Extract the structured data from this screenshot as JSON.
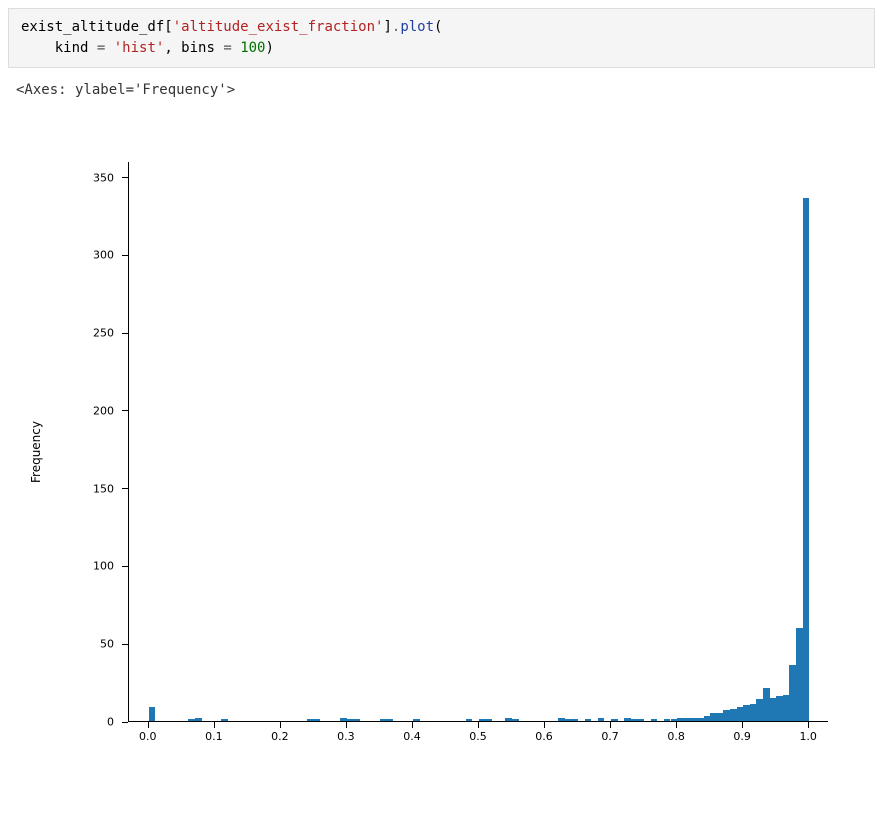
{
  "code": {
    "line1_parts": {
      "var": "exist_altitude_df",
      "lbracket": "[",
      "str": "'altitude_exist_fraction'",
      "rbracket": "]",
      "dot": ".",
      "call": "plot",
      "open": "("
    },
    "line2_parts": {
      "indent": "    ",
      "kw1": "kind",
      "eq": " = ",
      "str1": "'hist'",
      "comma": ", ",
      "kw2": "bins",
      "eq2": " = ",
      "num": "100",
      "close": ")"
    }
  },
  "output": "<Axes: ylabel='Frequency'>",
  "chart_data": {
    "type": "bar",
    "histogram": true,
    "title": "",
    "xlabel": "",
    "ylabel": "Frequency",
    "xlim": [
      -0.03,
      1.03
    ],
    "ylim": [
      0,
      360
    ],
    "xticks": [
      0.0,
      0.1,
      0.2,
      0.3,
      0.4,
      0.5,
      0.6,
      0.7,
      0.8,
      0.9,
      1.0
    ],
    "xticklabels": [
      "0.0",
      "0.1",
      "0.2",
      "0.3",
      "0.4",
      "0.5",
      "0.6",
      "0.7",
      "0.8",
      "0.9",
      "1.0"
    ],
    "yticks": [
      0,
      50,
      100,
      150,
      200,
      250,
      300,
      350
    ],
    "yticklabels": [
      "0",
      "50",
      "100",
      "150",
      "200",
      "250",
      "300",
      "350"
    ],
    "bin_edges_implied": "100 equal bins from 0.00 to 1.00 (edges at 0.00,0.01,...,1.00)",
    "values": [
      9,
      0,
      0,
      0,
      0,
      0,
      1,
      2,
      0,
      0,
      0,
      1,
      0,
      0,
      0,
      0,
      0,
      0,
      0,
      0,
      0,
      0,
      0,
      0,
      1,
      1,
      0,
      0,
      0,
      2,
      1,
      1,
      0,
      0,
      0,
      1,
      1,
      0,
      0,
      0,
      1,
      0,
      0,
      0,
      0,
      0,
      0,
      0,
      1,
      0,
      1,
      1,
      0,
      0,
      2,
      1,
      0,
      0,
      0,
      0,
      0,
      0,
      2,
      1,
      1,
      0,
      1,
      0,
      2,
      0,
      1,
      0,
      2,
      1,
      1,
      0,
      1,
      0,
      1,
      1,
      2,
      2,
      2,
      2,
      3,
      5,
      5,
      7,
      8,
      9,
      10,
      11,
      14,
      21,
      15,
      16,
      17,
      36,
      60,
      336
    ],
    "bar_color": "#1f77b4"
  }
}
